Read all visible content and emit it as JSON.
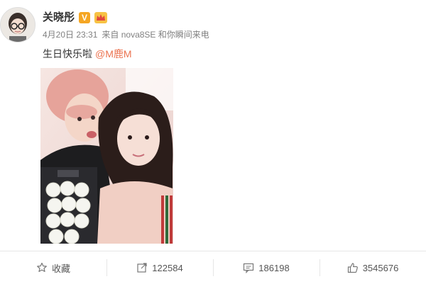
{
  "user": {
    "name": "关晓彤",
    "verified_mark": "V",
    "avatar_icon": "avatar-icon"
  },
  "meta": {
    "time": "4月20日 23:31",
    "source": "来自 nova8SE 和你瞬间来电"
  },
  "post": {
    "text": "生日快乐啦",
    "mention": "@M鹿M"
  },
  "actions": {
    "favorite": {
      "label": "收藏",
      "icon": "star-icon"
    },
    "repost": {
      "count": "122584",
      "icon": "repost-icon"
    },
    "comment": {
      "count": "186198",
      "icon": "comment-icon"
    },
    "like": {
      "count": "3545676",
      "icon": "thumbs-up-icon"
    }
  },
  "colors": {
    "mention": "#eb7350",
    "meta": "#808080",
    "badge": "#f5a623"
  }
}
